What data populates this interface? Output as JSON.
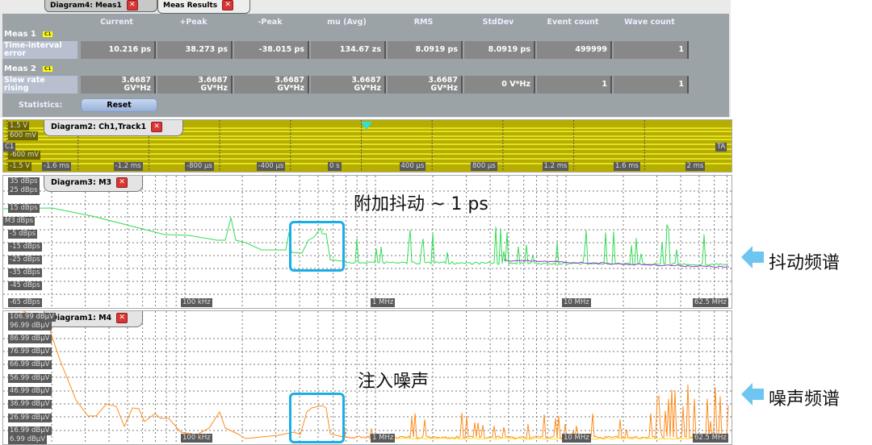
{
  "tabs": [
    {
      "label": "Diagram4: Meas1"
    },
    {
      "label": "Meas Results"
    }
  ],
  "meas_table": {
    "columns": [
      "Current",
      "+Peak",
      "-Peak",
      "mu (Avg)",
      "RMS",
      "StdDev",
      "Event count",
      "Wave count"
    ],
    "groups": [
      {
        "name": "Meas 1",
        "source": "C1",
        "row_label": "Time-interval error",
        "values": [
          "10.216 ps",
          "38.273 ps",
          "-38.015 ps",
          "134.67 zs",
          "8.0919 ps",
          "8.0919 ps",
          "499999",
          "1"
        ]
      },
      {
        "name": "Meas 2",
        "source": "C1",
        "row_label": "Slew rate rising",
        "values": [
          "3.6687 GV*Hz",
          "3.6687 GV*Hz",
          "3.6687 GV*Hz",
          "3.6687 GV*Hz",
          "3.6687 GV*Hz",
          "0 V*Hz",
          "1",
          "1"
        ]
      }
    ],
    "statistics_label": "Statistics:",
    "reset_label": "Reset"
  },
  "diagram2": {
    "title": "Diagram2: Ch1,Track1",
    "y_labels": [
      "1.5 V",
      "600 mV",
      "-600 mV",
      "-1.5 V"
    ],
    "channel_marker": "C1",
    "trigger_marker": "TA",
    "x_labels": [
      "-1.6 ms",
      "-1.2 ms",
      "-800 µs",
      "-400 µs",
      "0 s",
      "400 µs",
      "800 µs",
      "1.2 ms",
      "1.6 ms",
      "2 ms"
    ],
    "color": "#b5ad00"
  },
  "diagram3": {
    "title": "Diagram3: M3",
    "marker": "M3",
    "y_labels": [
      "35 dBps",
      "25 dBps",
      "15 dBps",
      "5 dBps",
      "-5 dBps",
      "-15 dBps",
      "-25 dBps",
      "-35 dBps",
      "-45 dBps",
      "-65 dBps"
    ],
    "x_labels": [
      "100 kHz",
      "1 MHz",
      "10 MHz",
      "62.5 MHz"
    ],
    "trace_color": "#33dd55"
  },
  "diagram1": {
    "title": "Diagram1: M4",
    "y_labels": [
      "106.99 dBµV",
      "96.99 dBµV",
      "86.99 dBµV",
      "76.99 dBµV",
      "66.99 dBµV",
      "56.99 dBµV",
      "46.99 dBµV",
      "36.99 dBµV",
      "26.99 dBµV",
      "16.99 dBµV",
      "6.99 dBµV"
    ],
    "x_labels": [
      "100 kHz",
      "1 MHz",
      "10 MHz",
      "62.5 MHz"
    ],
    "trace_color": "#ff8c1a"
  },
  "annotations": {
    "jitter_note": "附加抖动 ~ 1 ps",
    "jitter_spectrum": "抖动频谱",
    "noise_note": "注入噪声",
    "noise_spectrum": "噪声频谱",
    "highlight_color": "#1aaee8"
  }
}
